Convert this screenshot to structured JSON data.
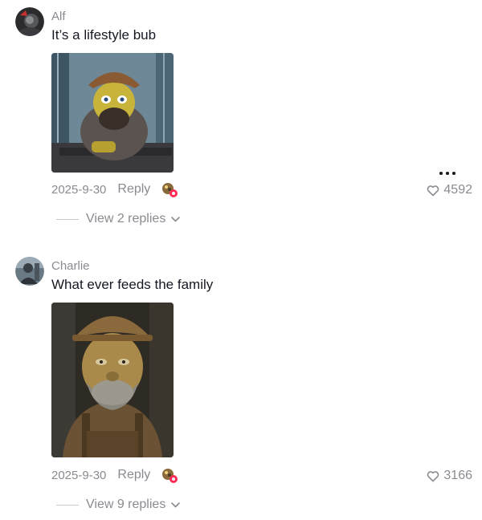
{
  "comments": [
    {
      "username": "Alf",
      "text": "It’s a lifestyle bub",
      "image_description_icon": "construction-worker-image",
      "date": "2025-9-30",
      "reply_label": "Reply",
      "likes": "4592",
      "view_replies": "View 2 replies"
    },
    {
      "username": "Charlie",
      "text": "What ever feeds the family",
      "image_description_icon": "construction-worker-image",
      "date": "2025-9-30",
      "reply_label": "Reply",
      "likes": "3166",
      "view_replies": "View 9 replies"
    }
  ],
  "icons": {
    "more": "more-options-icon",
    "heart": "heart-icon",
    "chevron": "chevron-down-icon",
    "emoji": "emoji-reaction-icon"
  },
  "colors": {
    "text_primary": "#161823",
    "text_secondary": "#8a8b91",
    "reaction_badge": "#fe2c55"
  }
}
